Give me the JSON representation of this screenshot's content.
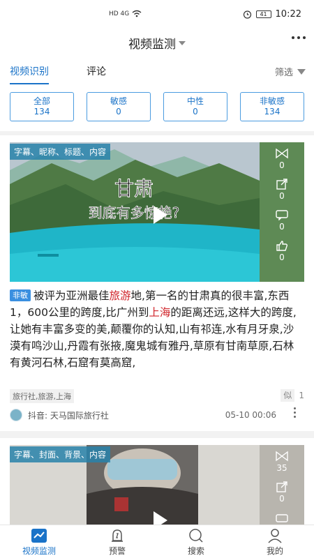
{
  "status_bar": {
    "network": "HD 4G",
    "battery": "41",
    "time": "10:22"
  },
  "header": {
    "title": "视频监测"
  },
  "tabs": [
    {
      "label": "视频识别"
    },
    {
      "label": "评论"
    }
  ],
  "filter_label": "筛选",
  "stats": [
    {
      "label": "全部",
      "count": "134"
    },
    {
      "label": "敏感",
      "count": "0"
    },
    {
      "label": "中性",
      "count": "0"
    },
    {
      "label": "非敏感",
      "count": "134"
    }
  ],
  "cards": [
    {
      "tag_label": "字幕、昵称、标题、内容",
      "video_title_text": "甘肃",
      "video_subtitle_text": "到底有多惊艳?",
      "metrics": [
        "0",
        "0",
        "0",
        "0"
      ],
      "badge": "非敏",
      "desc_parts": [
        "被评为亚洲最佳",
        "旅游",
        "地,第一名的甘肃真的很丰富,东西1，600公里的跨度,比广州到",
        "上海",
        "的距离还远,这样大的跨度,让她有丰富多变的美,颠覆你的认知,山有祁连,水有月牙泉,沙漠有鸣沙山,丹霞有张掖,魔鬼城有雅丹,草原有甘南草原,石林有黄河石林,石窟有莫高窟,"
      ],
      "tags": "旅行社,旅游,上海",
      "similar_label": "似",
      "similar_count": "1",
      "source": "抖音: 天马国际旅行社",
      "time": "05-10 00:06"
    },
    {
      "tag_label": "字幕、封面、背景、内容",
      "metrics": [
        "35",
        "0"
      ]
    }
  ],
  "bottom_nav": [
    {
      "label": "视频监测"
    },
    {
      "label": "预警"
    },
    {
      "label": "搜索"
    },
    {
      "label": "我的"
    }
  ],
  "colors": {
    "accent": "#1a73c8",
    "keyword": "#d0252b",
    "badge": "#3a8fe0"
  }
}
